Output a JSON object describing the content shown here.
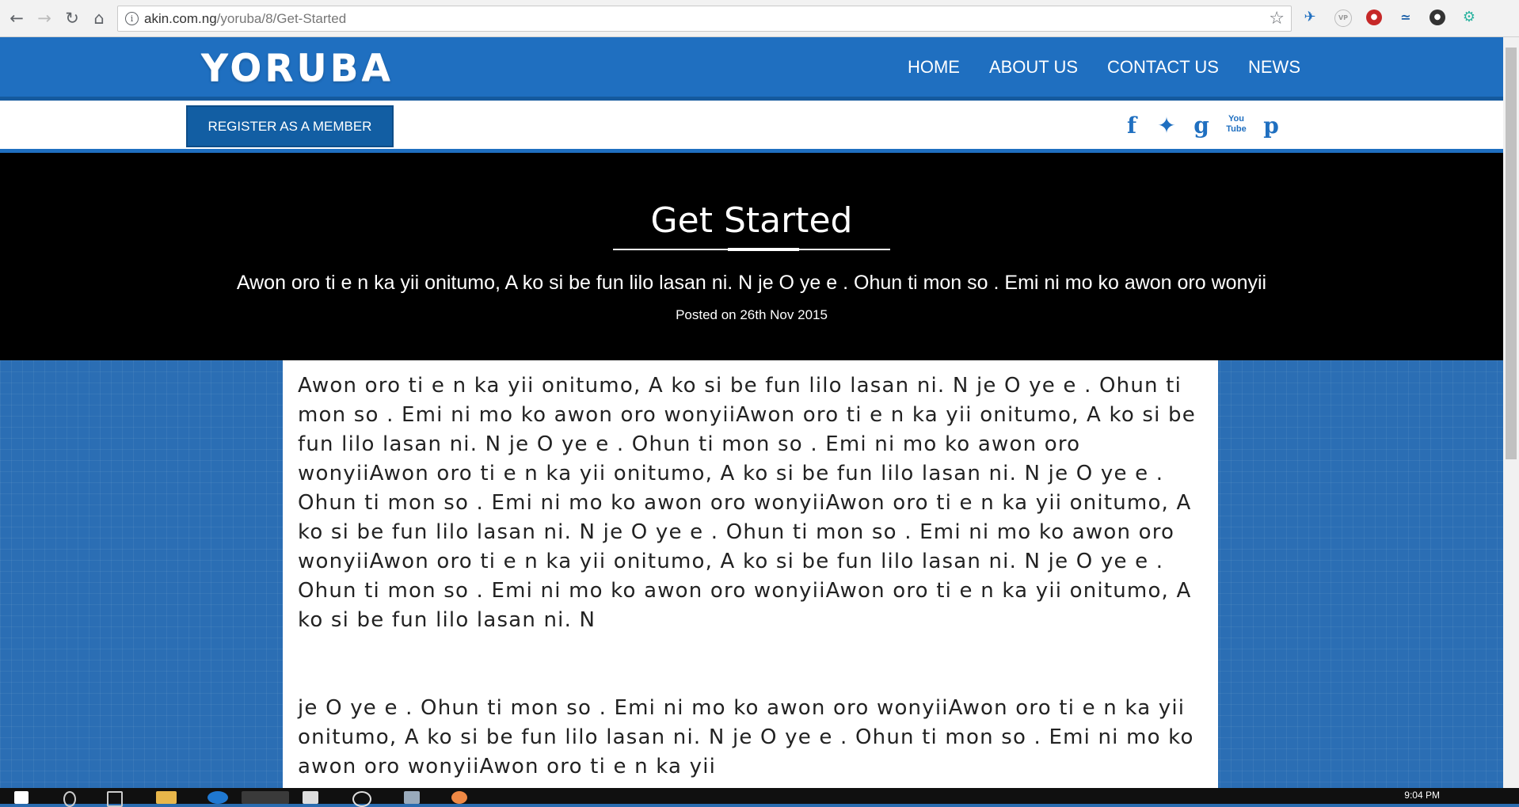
{
  "browser": {
    "url_host": "akin.com.ng",
    "url_path": "/yoruba/8/Get-Started"
  },
  "site": {
    "logo": "YORUBA",
    "nav": [
      "HOME",
      "ABOUT US",
      "CONTACT US",
      "NEWS"
    ],
    "register_label": "REGISTER AS A MEMBER",
    "social_icons": [
      "facebook-icon",
      "twitter-icon",
      "google-plus-icon",
      "youtube-icon",
      "pinterest-icon"
    ]
  },
  "hero": {
    "title": "Get Started",
    "subtitle": "Awon oro ti e n ka yii onitumo, A ko si be fun lilo lasan ni. N je O ye e . Ohun ti mon so . Emi ni mo ko awon oro wonyii",
    "posted": "Posted on 26th Nov 2015"
  },
  "article": {
    "paragraph_1": "Awon oro  ti e n ka yii  onitumo, A ko si be fun lilo lasan ni. N je O ye e . Ohun ti mon so . Emi ni mo ko awon oro wonyiiAwon oro  ti e n ka yii  onitumo, A ko si be fun lilo lasan ni. N je O ye e . Ohun ti mon so . Emi ni mo ko awon oro wonyiiAwon oro  ti e n ka yii  onitumo, A ko si be fun lilo lasan ni. N je O ye e . Ohun ti mon so . Emi ni mo ko awon oro wonyiiAwon oro  ti e n ka yii  onitumo, A ko si be fun lilo lasan ni. N je O ye e . Ohun ti mon so . Emi ni mo ko awon oro wonyiiAwon oro  ti e n ka yii  onitumo, A ko si be fun lilo lasan ni. N je O ye e . Ohun ti mon so . Emi ni mo ko awon oro wonyiiAwon oro  ti e n ka yii  onitumo, A ko si be fun lilo lasan ni. N",
    "paragraph_2": "je O ye e . Ohun ti mon so . Emi ni mo ko awon oro wonyiiAwon oro  ti e n ka yii  onitumo, A ko si be fun lilo lasan ni. N je O ye e . Ohun ti mon so . Emi ni mo ko awon oro wonyiiAwon oro  ti e n ka yii"
  },
  "taskbar": {
    "time": "9:04 PM"
  },
  "colors": {
    "brand_blue": "#1f6fc0",
    "button_blue": "#125ea3",
    "hero_bg": "#000000"
  }
}
